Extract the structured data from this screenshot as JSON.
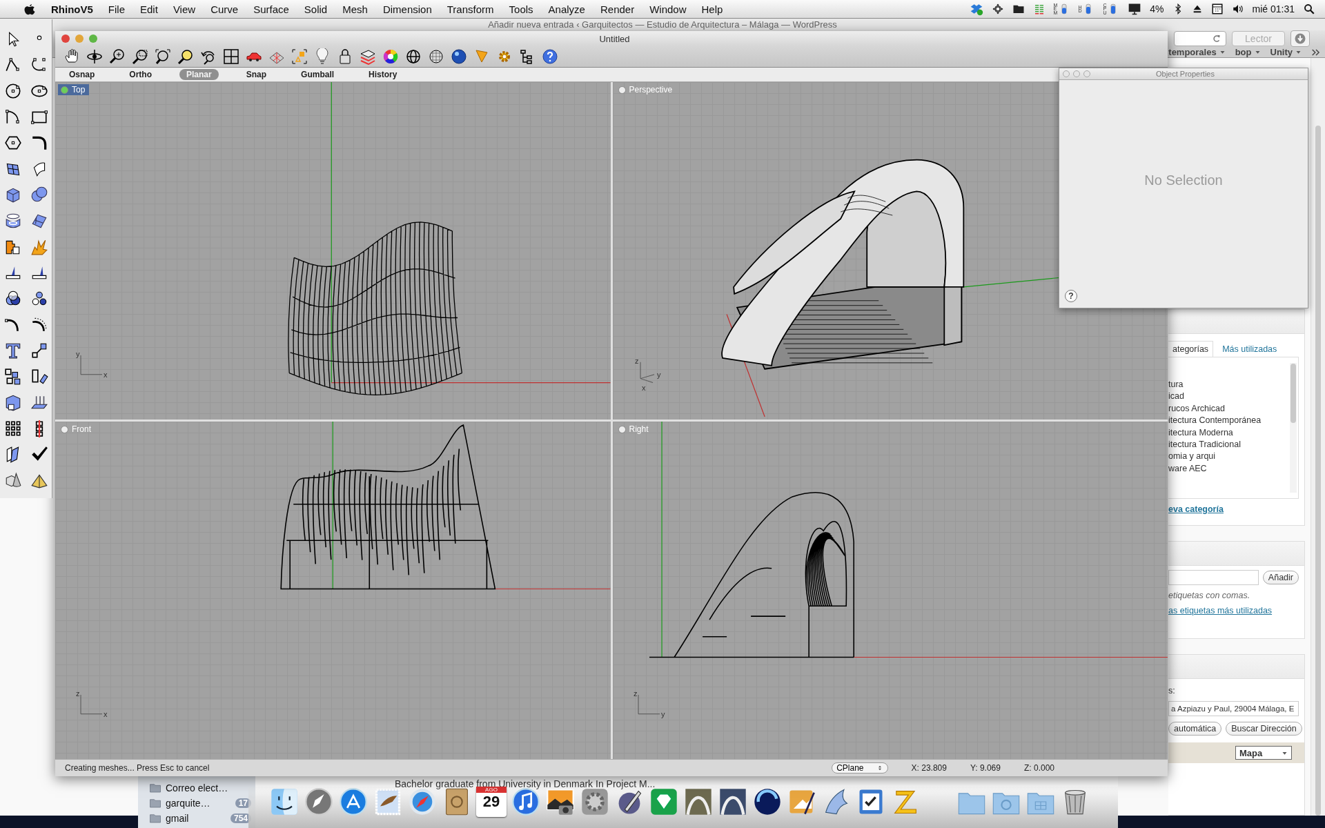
{
  "menu_bar": {
    "app_name": "RhinoV5",
    "menus": [
      "File",
      "Edit",
      "View",
      "Curve",
      "Surface",
      "Solid",
      "Mesh",
      "Dimension",
      "Transform",
      "Tools",
      "Analyze",
      "Render",
      "Window",
      "Help"
    ],
    "gauges": [
      "MEM",
      "HD",
      "CPU"
    ],
    "cpu_percent": "4%",
    "clock": "mié 01:31"
  },
  "browser": {
    "title": "Añadir nueva entrada ‹ Garquitectos — Estudio de Arquitectura – Málaga — WordPress",
    "reader_button": "Lector",
    "bookmarks": [
      "temporales",
      "bop",
      "Unity"
    ],
    "categories": {
      "tabs": [
        {
          "label": "ategorías",
          "selected": true
        },
        {
          "label": "Más utilizadas",
          "selected": false
        }
      ],
      "items": [
        "tura",
        "icad",
        "rucos Archicad",
        "itectura Contemporánea",
        "itectura Moderna",
        "itectura Tradicional",
        "omia y arqui",
        "ware AEC"
      ],
      "add_link": "eva categoría"
    },
    "tags": {
      "button": "Añadir",
      "hint": "etiquetas con comas.",
      "link": "as etiquetas más utilizadas"
    },
    "location": {
      "label": "s:",
      "address": "a Azpiazu y Paul, 29004 Málaga, E",
      "buttons": [
        "automática",
        "Buscar Dirección"
      ],
      "map_type": "Mapa"
    }
  },
  "rhino": {
    "title": "Untitled",
    "toggles": [
      {
        "label": "Osnap",
        "selected": false
      },
      {
        "label": "Ortho",
        "selected": false
      },
      {
        "label": "Planar",
        "selected": true
      },
      {
        "label": "Snap",
        "selected": false
      },
      {
        "label": "Gumball",
        "selected": false
      },
      {
        "label": "History",
        "selected": false
      }
    ],
    "viewports": [
      {
        "name": "Top",
        "kind": "top",
        "selected": true,
        "axes": [
          "y",
          "x"
        ]
      },
      {
        "name": "Perspective",
        "kind": "perspective",
        "selected": false,
        "axes": [
          "z",
          "x",
          "y"
        ]
      },
      {
        "name": "Front",
        "kind": "front",
        "selected": false,
        "axes": [
          "z",
          "x"
        ]
      },
      {
        "name": "Right",
        "kind": "right",
        "selected": false,
        "axes": [
          "z",
          "y"
        ]
      }
    ],
    "status": {
      "message": "Creating meshes... Press Esc to cancel",
      "cplane": "CPlane",
      "x": "X: 23.809",
      "y": "Y: 9.069",
      "z": "Z: 0.000"
    }
  },
  "object_properties": {
    "title": "Object Properties",
    "message": "No Selection",
    "help": "?"
  },
  "finder": {
    "snippet": "Bachelor graduate from University in Denmark In Project M...",
    "sidebar": [
      {
        "label": "Correo elect…"
      },
      {
        "label": "garquite…",
        "count": "17"
      },
      {
        "label": "gmail",
        "count": "754"
      }
    ]
  },
  "dock": {
    "calendar_month": "AGO",
    "calendar_day": "29"
  }
}
